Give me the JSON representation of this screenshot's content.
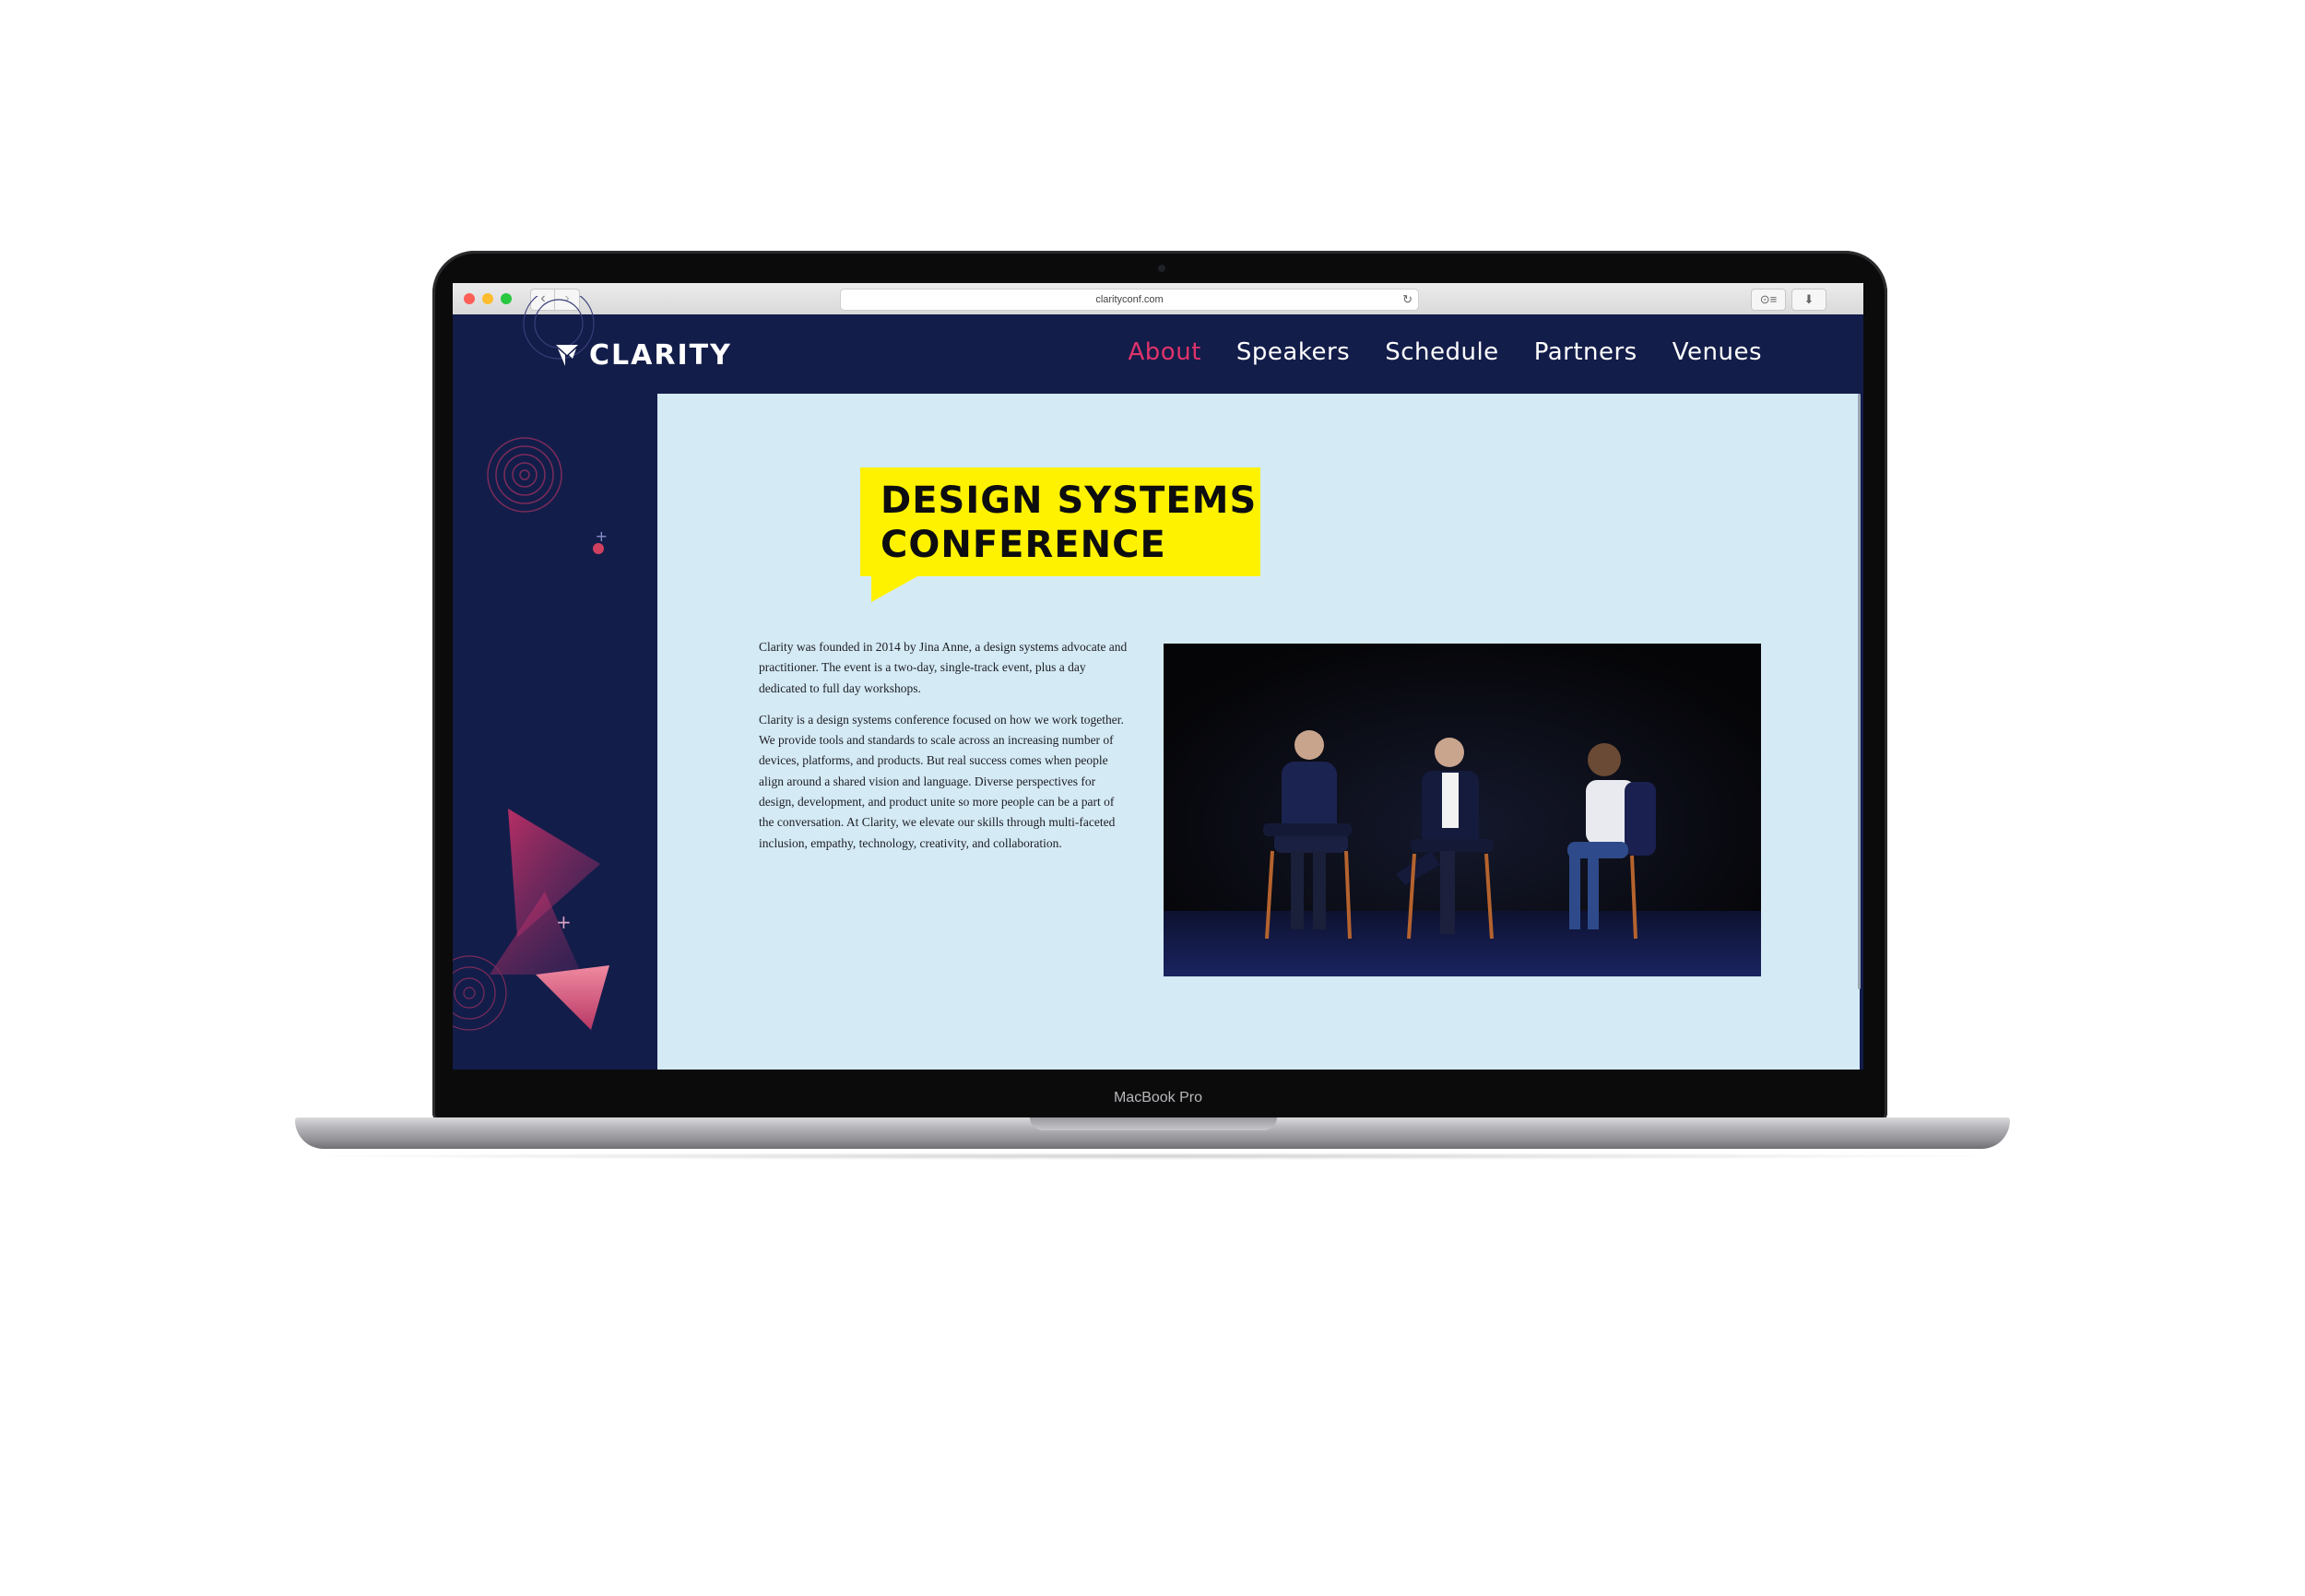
{
  "browser": {
    "url": "clarityconf.com",
    "back_glyph": "‹",
    "forward_glyph": "›",
    "reload_glyph": "↻",
    "reader_glyph": "⊙≡",
    "download_glyph": "⬇"
  },
  "laptop": {
    "label": "MacBook Pro"
  },
  "site": {
    "logo_text": "CLARITY",
    "nav": [
      {
        "label": "About",
        "active": true
      },
      {
        "label": "Speakers",
        "active": false
      },
      {
        "label": "Schedule",
        "active": false
      },
      {
        "label": "Partners",
        "active": false
      },
      {
        "label": "Venues",
        "active": false
      }
    ]
  },
  "hero": {
    "title_line1": "DESIGN SYSTEMS",
    "title_line2": "CONFERENCE"
  },
  "intro": {
    "paragraph1": "Clarity was founded in 2014 by Jina Anne, a design systems advocate and practitioner. The event is a two-day, single-track event, plus a day dedicated to full day workshops.",
    "paragraph2": "Clarity is a design systems conference focused on how we work together. We provide tools and standards to scale across an increasing number of devices, platforms, and products. But real success comes when people align around a shared vision and language. Diverse perspectives for design, development, and product unite so more people can be a part of the conversation. At Clarity, we elevate our skills through multi-faceted inclusion, empathy, technology, creativity, and collaboration."
  },
  "colors": {
    "navy": "#131d4a",
    "accent_pink": "#e0336b",
    "badge_yellow": "#fff200",
    "content_bg": "#d4eaf5"
  },
  "icons": [
    "clarity-logo-icon",
    "back-icon",
    "forward-icon",
    "reload-icon",
    "reader-icon",
    "download-icon"
  ]
}
